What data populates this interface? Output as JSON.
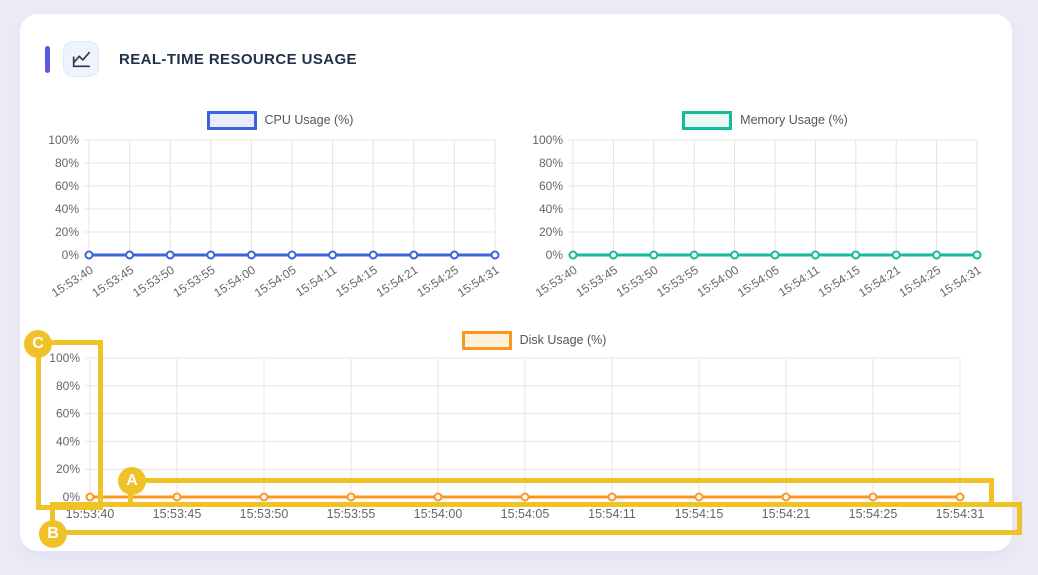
{
  "header": {
    "title": "REAL-TIME RESOURCE USAGE",
    "icon": "line-chart-icon"
  },
  "colors": {
    "page_bg": "#ECECF8",
    "card_bg": "#FFFFFF",
    "accent": "#5B59E0",
    "grid": "#E4E4E4",
    "tick_text": "#666666",
    "annotation": "#EFC227"
  },
  "chart_data": [
    {
      "type": "line",
      "title": "CPU Usage (%)",
      "legend_position": "top",
      "color": "#3A63DE",
      "fill_color": "#E9EDFB",
      "categories": [
        "15:53:40",
        "15:53:45",
        "15:53:50",
        "15:53:55",
        "15:54:00",
        "15:54:05",
        "15:54:11",
        "15:54:15",
        "15:54:21",
        "15:54:25",
        "15:54:31"
      ],
      "values": [
        0,
        0,
        0,
        0,
        0,
        0,
        0,
        0,
        0,
        0,
        0
      ],
      "ylim": [
        0,
        100
      ],
      "ytick_labels": [
        "0%",
        "20%",
        "40%",
        "60%",
        "80%",
        "100%"
      ],
      "grid": true,
      "x_labels_rotated": true
    },
    {
      "type": "line",
      "title": "Memory Usage (%)",
      "legend_position": "top",
      "color": "#17B99A",
      "fill_color": "#E9F8F2",
      "categories": [
        "15:53:40",
        "15:53:45",
        "15:53:50",
        "15:53:55",
        "15:54:00",
        "15:54:05",
        "15:54:11",
        "15:54:15",
        "15:54:21",
        "15:54:25",
        "15:54:31"
      ],
      "values": [
        0,
        0,
        0,
        0,
        0,
        0,
        0,
        0,
        0,
        0,
        0
      ],
      "ylim": [
        0,
        100
      ],
      "ytick_labels": [
        "0%",
        "20%",
        "40%",
        "60%",
        "80%",
        "100%"
      ],
      "grid": true,
      "x_labels_rotated": true
    },
    {
      "type": "line",
      "title": "Disk Usage (%)",
      "legend_position": "top",
      "color": "#F8991D",
      "fill_color": "#FDF0DC",
      "categories": [
        "15:53:40",
        "15:53:45",
        "15:53:50",
        "15:53:55",
        "15:54:00",
        "15:54:05",
        "15:54:11",
        "15:54:15",
        "15:54:21",
        "15:54:25",
        "15:54:31"
      ],
      "values": [
        0,
        0,
        0,
        0,
        0,
        0,
        0,
        0,
        0,
        0,
        0
      ],
      "ylim": [
        0,
        100
      ],
      "ytick_labels": [
        "0%",
        "20%",
        "40%",
        "60%",
        "80%",
        "100%"
      ],
      "grid": true,
      "x_labels_rotated": false
    }
  ],
  "annotations": {
    "color": "#EFC227",
    "items": [
      {
        "label": "A"
      },
      {
        "label": "B"
      },
      {
        "label": "C"
      }
    ]
  }
}
